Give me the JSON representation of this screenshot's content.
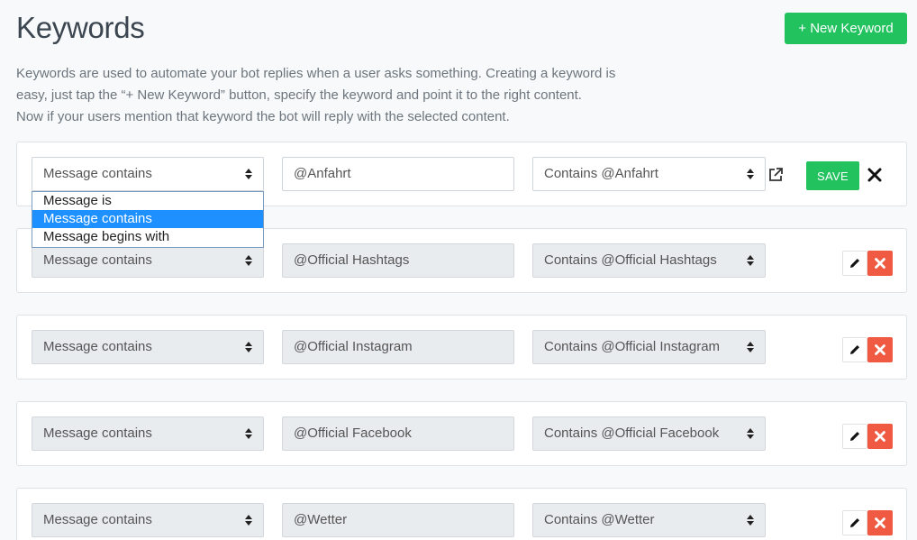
{
  "header": {
    "title": "Keywords",
    "new_button_label": "+ New Keyword"
  },
  "description": {
    "line1": "Keywords are used to automate your bot replies when a user asks something. Creating a keyword is",
    "line2": "easy, just tap the “+ New Keyword” button, specify the keyword and point it to the right content.",
    "line3": "Now if your users mention that keyword the bot will reply with the selected content."
  },
  "editing_row": {
    "condition": "Message contains",
    "keyword": "@Anfahrt",
    "content": "Contains @Anfahrt",
    "save_label": "SAVE"
  },
  "dropdown": {
    "options": [
      "Message is",
      "Message contains",
      "Message begins with"
    ],
    "selected": "Message contains"
  },
  "keywords": [
    {
      "condition": "Message contains",
      "keyword": "@Official Hashtags",
      "content": "Contains @Official Hashtags"
    },
    {
      "condition": "Message contains",
      "keyword": "@Official Instagram",
      "content": "Contains @Official Instagram"
    },
    {
      "condition": "Message contains",
      "keyword": "@Official Facebook",
      "content": "Contains @Official Facebook"
    },
    {
      "condition": "Message contains",
      "keyword": "@Wetter",
      "content": "Contains @Wetter"
    }
  ],
  "colors": {
    "accent_green": "#22c25f",
    "delete_red": "#f05a42",
    "dropdown_highlight": "#1e90ff"
  }
}
